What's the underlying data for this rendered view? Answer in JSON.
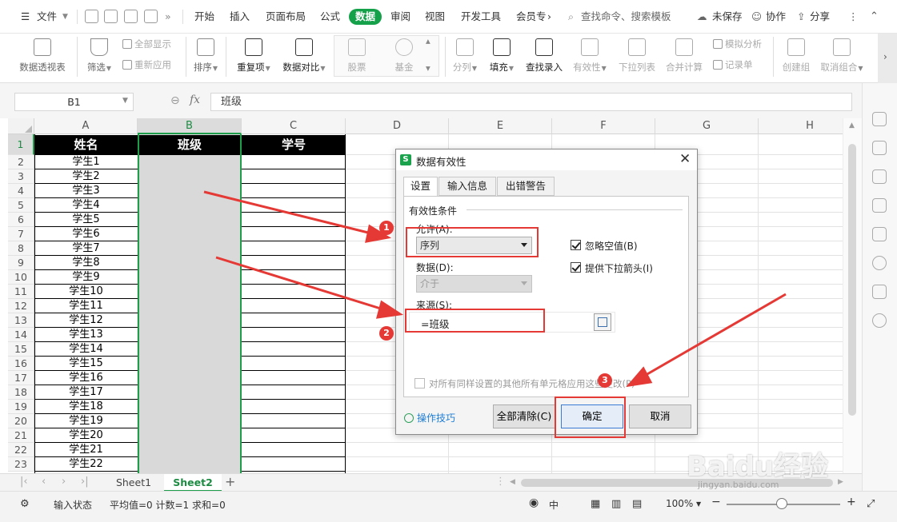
{
  "menubar": {
    "file": "文件",
    "tabs": [
      "开始",
      "插入",
      "页面布局",
      "公式",
      "数据",
      "审阅",
      "视图",
      "开发工具",
      "会员专"
    ],
    "active_tab": "数据",
    "search": "查找命令、搜索模板",
    "unsaved": "未保存",
    "collab": "协作",
    "share": "分享"
  },
  "ribbon": {
    "pivot": "数据透视表",
    "filter": "筛选",
    "show_all": "全部显示",
    "reapply": "重新应用",
    "sort": "排序",
    "duplicates": "重复项",
    "compare": "数据对比",
    "stock": "股票",
    "fund": "基金",
    "split": "分列",
    "fill": "填充",
    "lookup": "查找录入",
    "validity": "有效性",
    "dropdown": "下拉列表",
    "consolidate": "合并计算",
    "simulate": "模拟分析",
    "record": "记录单",
    "group": "创建组",
    "ungroup": "取消组合"
  },
  "formula": {
    "cell_ref": "B1",
    "fx": "fx",
    "content": "班级"
  },
  "grid": {
    "columns": [
      "A",
      "B",
      "C",
      "D",
      "E",
      "F",
      "G",
      "H"
    ],
    "selected_column": "B",
    "headers": [
      "姓名",
      "班级",
      "学号"
    ],
    "rows": [
      "1",
      "2",
      "3",
      "4",
      "5",
      "6",
      "7",
      "8",
      "9",
      "10",
      "11",
      "12",
      "13",
      "14",
      "15",
      "16",
      "17",
      "18",
      "19",
      "20",
      "21",
      "22",
      "23"
    ],
    "names": [
      "学生1",
      "学生2",
      "学生3",
      "学生4",
      "学生5",
      "学生6",
      "学生7",
      "学生8",
      "学生9",
      "学生10",
      "学生11",
      "学生12",
      "学生13",
      "学生14",
      "学生15",
      "学生16",
      "学生17",
      "学生18",
      "学生19",
      "学生20",
      "学生21",
      "学生22"
    ]
  },
  "sheets": {
    "tabs": [
      "Sheet1",
      "Sheet2"
    ],
    "active": "Sheet2"
  },
  "status": {
    "mode": "输入状态",
    "stats": "平均值=0  计数=1  求和=0",
    "zoom": "100%",
    "ime": "中"
  },
  "dialog": {
    "title": "数据有效性",
    "tabs": [
      "设置",
      "输入信息",
      "出错警告"
    ],
    "group_label": "有效性条件",
    "allow_label": "允许(A):",
    "allow_value": "序列",
    "ignore_blank": "忽略空值(B)",
    "dropdown_arrow": "提供下拉箭头(I)",
    "data_label": "数据(D):",
    "data_value": "介于",
    "source_label": "来源(S):",
    "source_value": "=班级",
    "apply_all": "对所有同样设置的其他所有单元格应用这些更改(P)",
    "help": "操作技巧",
    "clear_all": "全部清除(C)",
    "ok": "确定",
    "cancel": "取消"
  },
  "annotations": [
    "1",
    "2",
    "3"
  ],
  "watermark": {
    "logo": "Baidu经验",
    "url": "jingyan.baidu.com"
  },
  "colors": {
    "accent": "#15a04a",
    "annotation": "#e53935",
    "header_fill": "#000000",
    "selection_fill": "#d9d9d9"
  }
}
